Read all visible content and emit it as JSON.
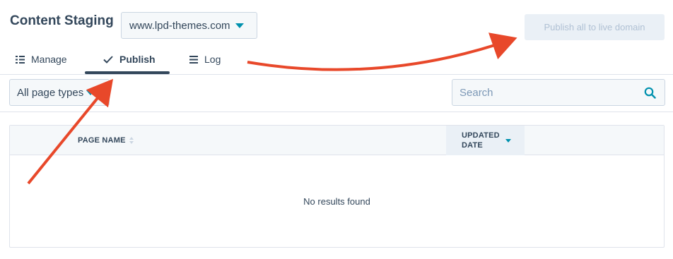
{
  "header": {
    "title": "Content Staging",
    "domain_select": {
      "value": "www.lpd-themes.com"
    },
    "publish_all_label": "Publish all to live domain"
  },
  "tabs": [
    {
      "label": "Manage",
      "icon": "list-icon"
    },
    {
      "label": "Publish",
      "icon": "checkmark-icon",
      "active": true
    },
    {
      "label": "Log",
      "icon": "lines-icon"
    }
  ],
  "filters": {
    "page_type": {
      "value": "All page types"
    },
    "search": {
      "placeholder": "Search",
      "value": ""
    }
  },
  "table": {
    "columns": [
      {
        "label": "PAGE NAME"
      },
      {
        "label_line1": "UPDATED",
        "label_line2": "DATE"
      }
    ],
    "empty_message": "No results found"
  },
  "colors": {
    "text": "#33475b",
    "accent": "#0091ae",
    "annotation_arrow": "#e8482a",
    "disabled_button_bg": "#eaf0f6",
    "disabled_button_text": "#b0c1d4"
  }
}
